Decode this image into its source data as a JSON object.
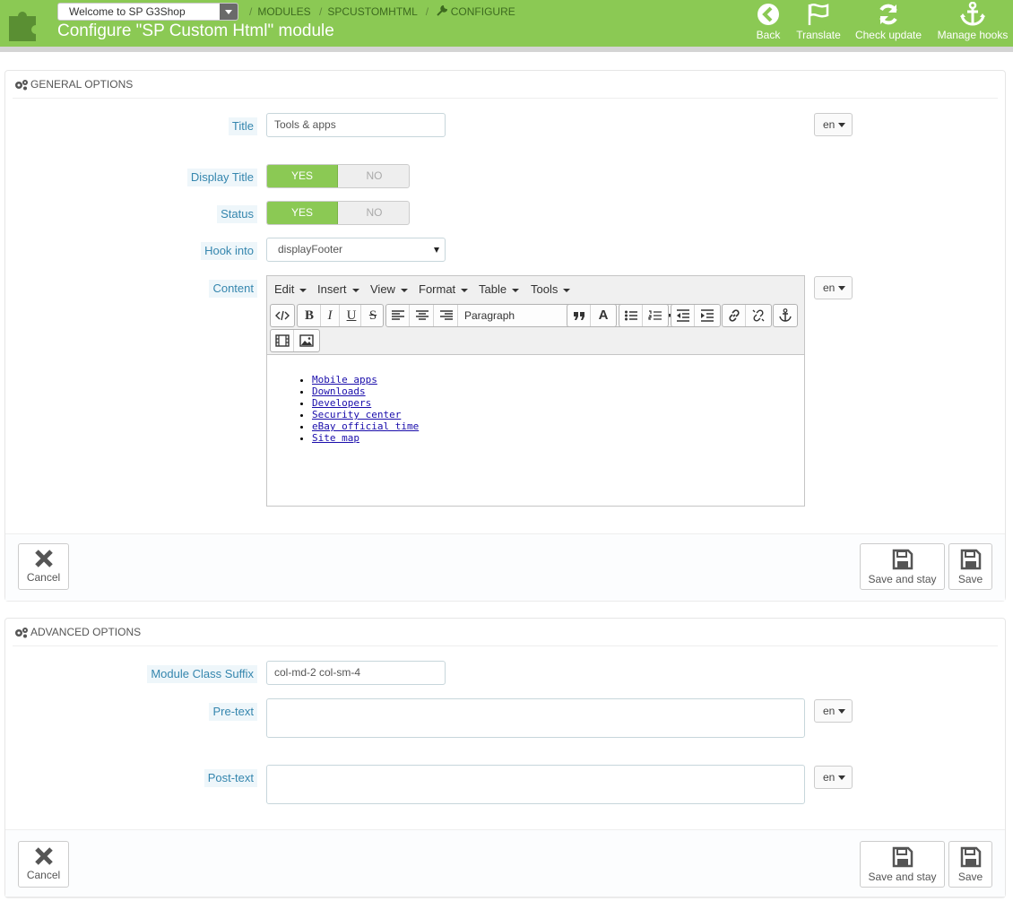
{
  "header": {
    "shop_select": "Welcome to SP G3Shop",
    "breadcrumb": {
      "modules": "Modules",
      "module": "SPCUSTOMHTML",
      "configure": "Configure"
    },
    "title": "Configure \"SP Custom Html\" module",
    "toolbar": {
      "back": "Back",
      "translate": "Translate",
      "check_update": "Check update",
      "manage_hooks": "Manage hooks"
    }
  },
  "general": {
    "heading": "General options",
    "title_label": "Title",
    "title_value": "Tools & apps",
    "lang": "en",
    "display_title_label": "Display Title",
    "status_label": "Status",
    "yes": "YES",
    "no": "NO",
    "hook_label": "Hook into",
    "hook_value": "displayFooter",
    "content_label": "Content",
    "editor": {
      "menus": [
        "Edit",
        "Insert",
        "View",
        "Format",
        "Table",
        "Tools"
      ],
      "paragraph": "Paragraph",
      "links": [
        "Mobile apps",
        "Downloads",
        "Developers",
        "Security center",
        "eBay official time",
        "Site map"
      ]
    },
    "cancel": "Cancel",
    "save_stay": "Save and stay",
    "save": "Save"
  },
  "advanced": {
    "heading": "Advanced options",
    "suffix_label": "Module Class Suffix",
    "suffix_value": "col-md-2 col-sm-4",
    "pretext_label": "Pre-text",
    "posttext_label": "Post-text",
    "lang": "en",
    "cancel": "Cancel",
    "save_stay": "Save and stay",
    "save": "Save"
  }
}
